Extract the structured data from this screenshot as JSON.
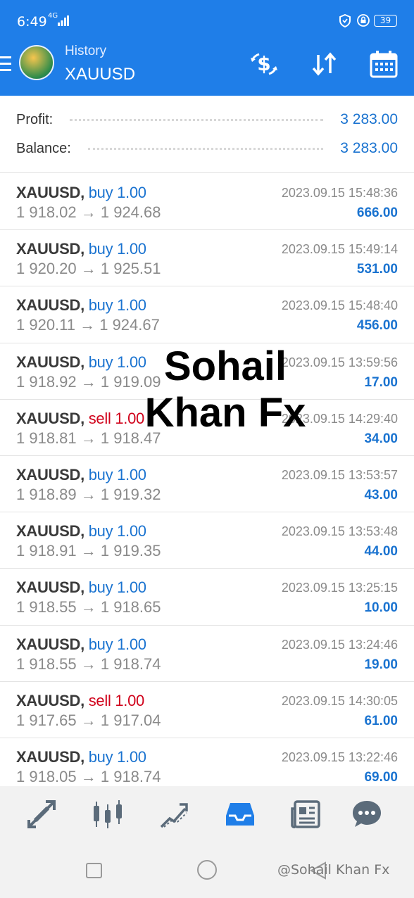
{
  "status_bar": {
    "time": "6:49",
    "network": "4G",
    "battery": "39"
  },
  "app_bar": {
    "subtitle": "History",
    "title": "XAUUSD"
  },
  "summary": {
    "profit_label": "Profit:",
    "profit_value": "3 283.00",
    "balance_label": "Balance:",
    "balance_value": "3 283.00"
  },
  "trades": [
    {
      "symbol": "XAUUSD,",
      "side": "buy 1.00",
      "type": "buy",
      "prices": "1 918.02 → 1 924.68",
      "time": "2023.09.15 15:48:36",
      "profit": "666.00"
    },
    {
      "symbol": "XAUUSD,",
      "side": "buy 1.00",
      "type": "buy",
      "prices": "1 920.20 → 1 925.51",
      "time": "2023.09.15 15:49:14",
      "profit": "531.00"
    },
    {
      "symbol": "XAUUSD,",
      "side": "buy 1.00",
      "type": "buy",
      "prices": "1 920.11 → 1 924.67",
      "time": "2023.09.15 15:48:40",
      "profit": "456.00"
    },
    {
      "symbol": "XAUUSD,",
      "side": "buy 1.00",
      "type": "buy",
      "prices": "1 918.92 → 1 919.09",
      "time": "2023.09.15 13:59:56",
      "profit": "17.00"
    },
    {
      "symbol": "XAUUSD,",
      "side": "sell 1.00",
      "type": "sell",
      "prices": "1 918.81 → 1 918.47",
      "time": "2023.09.15 14:29:40",
      "profit": "34.00"
    },
    {
      "symbol": "XAUUSD,",
      "side": "buy 1.00",
      "type": "buy",
      "prices": "1 918.89 → 1 919.32",
      "time": "2023.09.15 13:53:57",
      "profit": "43.00"
    },
    {
      "symbol": "XAUUSD,",
      "side": "buy 1.00",
      "type": "buy",
      "prices": "1 918.91 → 1 919.35",
      "time": "2023.09.15 13:53:48",
      "profit": "44.00"
    },
    {
      "symbol": "XAUUSD,",
      "side": "buy 1.00",
      "type": "buy",
      "prices": "1 918.55 → 1 918.65",
      "time": "2023.09.15 13:25:15",
      "profit": "10.00"
    },
    {
      "symbol": "XAUUSD,",
      "side": "buy 1.00",
      "type": "buy",
      "prices": "1 918.55 → 1 918.74",
      "time": "2023.09.15 13:24:46",
      "profit": "19.00"
    },
    {
      "symbol": "XAUUSD,",
      "side": "sell 1.00",
      "type": "sell",
      "prices": "1 917.65 → 1 917.04",
      "time": "2023.09.15 14:30:05",
      "profit": "61.00"
    },
    {
      "symbol": "XAUUSD,",
      "side": "buy 1.00",
      "type": "buy",
      "prices": "1 918.05 → 1 918.74",
      "time": "2023.09.15 13:22:46",
      "profit": "69.00"
    }
  ],
  "watermark": {
    "line1": "Sohail",
    "line2": "Khan Fx"
  },
  "bottom_nav": [
    "quotes-icon",
    "chart-icon",
    "trade-icon",
    "history-icon",
    "news-icon",
    "chat-icon"
  ],
  "system_bar": {
    "tag": "@Sohail Khan Fx"
  },
  "colors": {
    "primary": "#1f7ee8",
    "buy": "#1a73d0",
    "sell": "#d0021b",
    "text_muted": "#8a8a8a"
  }
}
